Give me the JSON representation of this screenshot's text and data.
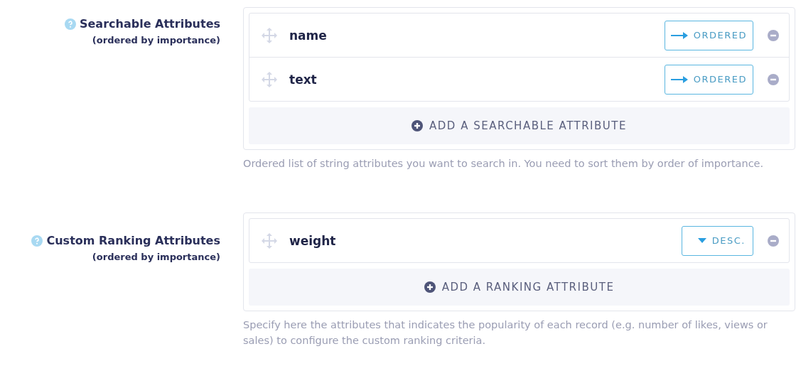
{
  "sections": [
    {
      "title": "Searchable Attributes",
      "subtitle": "(ordered by importance)",
      "attributes": [
        {
          "name": "name",
          "order": {
            "kind": "ordered",
            "label": "ORDERED"
          }
        },
        {
          "name": "text",
          "order": {
            "kind": "ordered",
            "label": "ORDERED"
          }
        }
      ],
      "add_button": "ADD A SEARCHABLE ATTRIBUTE",
      "description": "Ordered list of string attributes you want to search in. You need to sort them by order of importance."
    },
    {
      "title": "Custom Ranking Attributes",
      "subtitle": "(ordered by importance)",
      "attributes": [
        {
          "name": "weight",
          "order": {
            "kind": "desc",
            "label": "DESC."
          }
        }
      ],
      "add_button": "ADD A RANKING ATTRIBUTE",
      "description": "Specify here the attributes that indicates the popularity of each record (e.g. number of likes, views or sales) to configure the custom ranking criteria."
    }
  ]
}
